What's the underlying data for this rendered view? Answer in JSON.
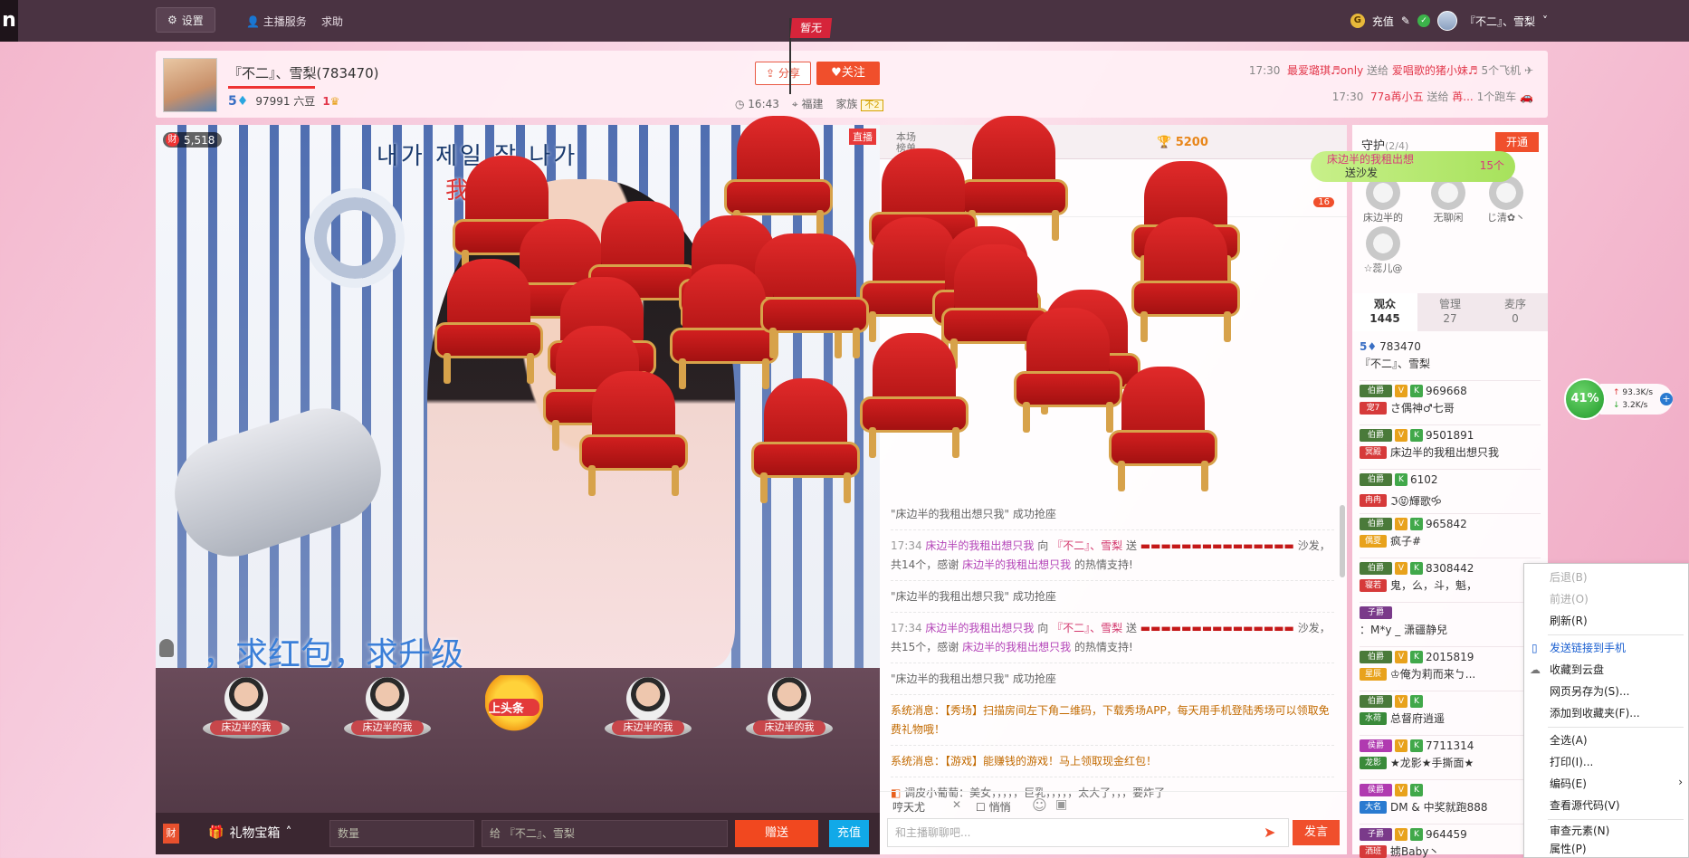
{
  "topbar": {
    "logo": "n",
    "settings": "设置",
    "host_service": "主播服务",
    "help": "求助",
    "recharge": "充值",
    "username": "『不二』、雪梨"
  },
  "header": {
    "name": "『不二』、雪梨(783470)",
    "level": "5",
    "beans": "97991 六豆",
    "rank": "1",
    "share": "分享",
    "follow": "关注",
    "time": "16:43",
    "location": "福建",
    "family_label": "家族",
    "family_badge": "不2",
    "flag": "暂无",
    "ticker": [
      {
        "time": "17:30",
        "from": "最爱璐琪♬only",
        "act": "送给",
        "to": "爱唱歌的猪小妹♬",
        "gift": "5个飞机"
      },
      {
        "time": "17:30",
        "from": "77a苒小五",
        "act": "送给",
        "to": "苒...",
        "gift": "1个跑车"
      }
    ]
  },
  "video": {
    "fans_count": "5,518",
    "fans_badge": "财",
    "live": "直播",
    "korean_text": "내가 제일 잘 나가",
    "overlay_red": "我最红",
    "bottom_text": "，求红包，求升级"
  },
  "seats": [
    {
      "label": "床边半的我"
    },
    {
      "label": "床边半的我"
    },
    {
      "label": "上头条"
    },
    {
      "label": "床边半的我"
    },
    {
      "label": "床边半的我"
    }
  ],
  "giftbar": {
    "cai": "财",
    "treasure": "礼物宝箱",
    "qty_placeholder": "数量",
    "to_label": "给 『不二』、雪梨",
    "give": "赠送",
    "charge": "充值"
  },
  "chat": {
    "tag1": "本场",
    "tag2": "榜单",
    "score": "5200",
    "badge": "16",
    "msgs": [
      {
        "type": "sys_note",
        "text": "\"床边半的我租出想只我\" 成功抢座"
      },
      {
        "type": "gift",
        "time": "17:34",
        "from": "床边半的我租出想只我",
        "verb": "向",
        "host": "『不二』、雪梨",
        "act": "送",
        "tail": "沙发，共14个，感谢",
        "thanks_user": "床边半的我租出想只我",
        "end": "的热情支持!"
      },
      {
        "type": "sys_note",
        "text": "\"床边半的我租出想只我\" 成功抢座"
      },
      {
        "type": "gift",
        "time": "17:34",
        "from": "床边半的我租出想只我",
        "verb": "向",
        "host": "『不二』、雪梨",
        "act": "送",
        "tail": "沙发，共15个，感谢",
        "thanks_user": "床边半的我租出想只我",
        "end": "的热情支持!"
      },
      {
        "type": "sys_note",
        "text": "\"床边半的我租出想只我\" 成功抢座"
      }
    ],
    "sys1": "系统消息：【秀场】扫描房间左下角二维码，下载秀场APP，每天用手机登陆秀场可以领取免费礼物哦！",
    "sys2": "系统消息：【游戏】能赚钱的游戏！马上领取现金红包！",
    "last": "调皮小葡萄：美女，，，，，巨乳，，，，，太大了，，，要炸了",
    "target": "哼天尤",
    "whisper": "悄悄",
    "input_placeholder": "和主播聊聊吧...",
    "send": "发言"
  },
  "right": {
    "guard_title": "守护",
    "guard_count": "(2/4)",
    "open": "开通",
    "guards": [
      {
        "name": "床边半的"
      },
      {
        "name": "无聊闲"
      },
      {
        "name": "じ清✿丶"
      },
      {
        "name": "☆蕊儿@"
      }
    ],
    "tabs": [
      {
        "label": "观众",
        "count": "1445"
      },
      {
        "label": "管理",
        "count": "27"
      },
      {
        "label": "麦序",
        "count": "0"
      }
    ],
    "users": [
      {
        "id": "783470",
        "name": "『不二』、雪梨",
        "tag": ""
      },
      {
        "id": "969668",
        "name": "さ偶神♂七哥",
        "tag": "宠7"
      },
      {
        "id": "9501891",
        "name": "床边半的我租出想只我",
        "tag": "冥殿"
      },
      {
        "id": "6102",
        "name": "ℑ😝輝歌🝰",
        "tag": "冉冉"
      },
      {
        "id": "965842",
        "name": "疯子#",
        "tag": "偶夏"
      },
      {
        "id": "8308442",
        "name": "鬼，么，斗，魁，",
        "tag": "寝若"
      },
      {
        "id": "",
        "name": "：M*y _ 潇疆静兒",
        "tag": ""
      },
      {
        "id": "2015819",
        "name": "♔俺为莉而来ㄅ...",
        "tag": "星辰"
      },
      {
        "id": "",
        "name": "总督府逍遥",
        "tag": "水荷"
      },
      {
        "id": "7711314",
        "name": "★龙影★手撕面★",
        "tag": "龙影"
      },
      {
        "id": "",
        "name": "DM & 中奖就跑888",
        "tag": "大名"
      },
      {
        "id": "964459",
        "name": "掳Baby丶",
        "tag": "洒班"
      }
    ]
  },
  "bubble": {
    "line1": "床边半的我租出想",
    "line2": "送沙发",
    "count": "15个"
  },
  "speed": {
    "percent": "41%",
    "up": "93.3K/s",
    "down": "3.2K/s"
  },
  "context_menu": {
    "items": [
      {
        "label": "后退(B)",
        "state": "disabled"
      },
      {
        "label": "前进(O)",
        "state": "disabled"
      },
      {
        "label": "刷新(R)",
        "state": "normal"
      },
      {
        "label": "发送链接到手机",
        "state": "blue"
      },
      {
        "label": "收藏到云盘",
        "state": "normal"
      },
      {
        "label": "网页另存为(S)...",
        "state": "normal"
      },
      {
        "label": "添加到收藏夹(F)...",
        "state": "normal"
      },
      {
        "label": "全选(A)",
        "state": "normal"
      },
      {
        "label": "打印(I)...",
        "state": "normal"
      },
      {
        "label": "编码(E)",
        "state": "normal"
      },
      {
        "label": "查看源代码(V)",
        "state": "normal"
      },
      {
        "label": "审查元素(N)",
        "state": "normal"
      },
      {
        "label": "属性(P)",
        "state": "normal"
      }
    ]
  }
}
